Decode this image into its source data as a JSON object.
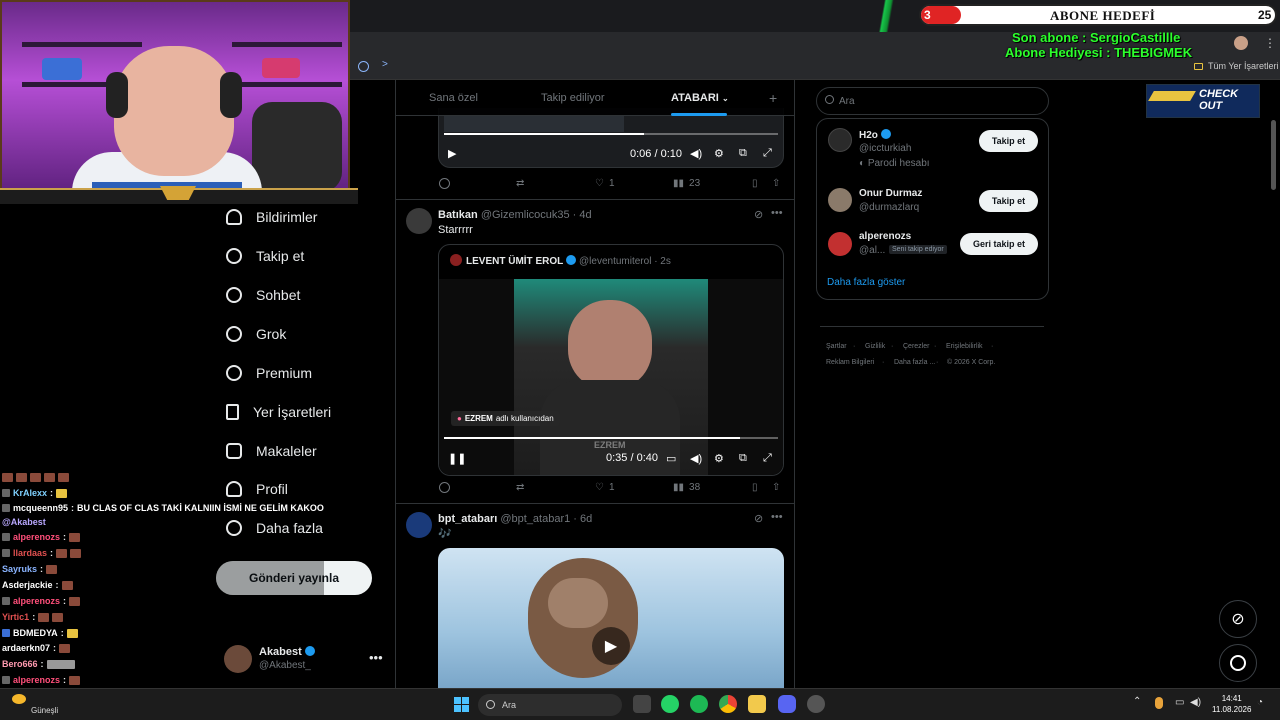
{
  "overlay": {
    "goal_left": "3",
    "goal_title": "ABONE HEDEFİ",
    "goal_right": "25",
    "last_sub": "Son abone : SergioCastillle",
    "gift_sub": "Abone Hediyesi : THEBIGMEK",
    "checkout": "CHECK OUT"
  },
  "browser": {
    "all_bookmarks": "Tüm Yer İşaretleri"
  },
  "nav": {
    "items": [
      {
        "label": "Bildirimler",
        "icon": "bell-icon"
      },
      {
        "label": "Takip et",
        "icon": "person-add-icon"
      },
      {
        "label": "Sohbet",
        "icon": "chat-icon"
      },
      {
        "label": "Grok",
        "icon": "grok-icon"
      },
      {
        "label": "Premium",
        "icon": "premium-icon"
      },
      {
        "label": "Yer İşaretleri",
        "icon": "bookmark-icon"
      },
      {
        "label": "Makaleler",
        "icon": "articles-icon"
      },
      {
        "label": "Profil",
        "icon": "profile-icon"
      },
      {
        "label": "Daha fazla",
        "icon": "more-circle-icon"
      }
    ],
    "post_button": "Gönderi yayınla",
    "account_name": "Akabest",
    "account_handle": "@Akabest_"
  },
  "feed": {
    "tabs": [
      "Sana özel",
      "Takip ediliyor",
      "ATABARI"
    ],
    "tweet1": {
      "time": "0:06 / 0:10",
      "likes": "1",
      "views": "23"
    },
    "tweet2": {
      "name": "Batıkan",
      "handle": "@Gizemlicocuk35 · 4d",
      "text": "Starrrrr",
      "quote_name": "LEVENT ÜMİT EROL",
      "quote_handle": "@leventumiterol · 2s",
      "caption_user": "EZREM",
      "caption_rest": "adlı kullanıcıdan",
      "watermark": "EZREM",
      "time": "0:35 / 0:40",
      "likes": "1",
      "views": "38"
    },
    "tweet3": {
      "name": "bpt_atabarı",
      "handle": "@bpt_atabar1 · 6d",
      "text": "🎶"
    }
  },
  "right": {
    "search_placeholder": "Ara",
    "who": [
      {
        "name": "H2o",
        "handle": "@iccturkiah",
        "sub": "Parodi hesabı",
        "button": "Takip et"
      },
      {
        "name": "Onur Durmaz",
        "handle": "@durmazlarq",
        "button": "Takip et"
      },
      {
        "name": "alperenozs",
        "handle": "@al...",
        "badge": "Seni takip ediyor",
        "button": "Geri takip et"
      }
    ],
    "show_more": "Daha fazla göster",
    "footer1": [
      "Şartlar",
      "Gizlilik",
      "Çerezler",
      "Erişilebilirlik"
    ],
    "footer2": [
      "Reklam Bilgileri",
      "Daha fazla ...",
      "© 2026 X Corp."
    ]
  },
  "chat": [
    {
      "user": "KrAlexx",
      "color": "#7fd1ff",
      "msg": ""
    },
    {
      "user": "mcqueenn95",
      "color": "#ffffff",
      "msg": "BU CLAS OF CLAS TAKİ KALNIIN İSMİ NE GELİM KAKOO"
    },
    {
      "user": "@Akabest",
      "color": "#b9a8ff",
      "msg": ""
    },
    {
      "user": "alperenozs",
      "color": "#ff4f7a",
      "msg": ""
    },
    {
      "user": "llardaas",
      "color": "#e05050",
      "msg": ""
    },
    {
      "user": "Sayruks",
      "color": "#8ab4ff",
      "msg": ""
    },
    {
      "user": "Asderjackie",
      "color": "#ffffff",
      "msg": ""
    },
    {
      "user": "alperenozs",
      "color": "#ff4f7a",
      "msg": ""
    },
    {
      "user": "Yirtic1",
      "color": "#e05050",
      "msg": ""
    },
    {
      "user": "BDMEDYA",
      "color": "#ffffff",
      "msg": ""
    },
    {
      "user": "ardaerkn07",
      "color": "#ffffff",
      "msg": ""
    },
    {
      "user": "Bero666",
      "color": "#ff9ab0",
      "msg": ""
    },
    {
      "user": "alperenozs",
      "color": "#ff4f7a",
      "msg": ""
    }
  ],
  "taskbar": {
    "weather": "Güneşli",
    "search": "Ara",
    "time": "14:41",
    "date": "11.08.2026"
  }
}
